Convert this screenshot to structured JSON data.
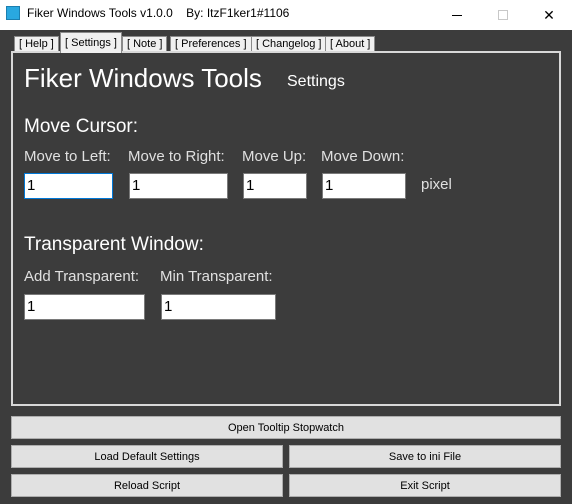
{
  "window": {
    "title": "Fiker Windows Tools v1.0.0    By: ItzF1ker1#1106"
  },
  "tabs": [
    {
      "label": "[ Help ]"
    },
    {
      "label": "[ Settings ]"
    },
    {
      "label": "[ Note ]"
    },
    {
      "label": "[ Preferences ]"
    },
    {
      "label": "[ Changelog ]"
    },
    {
      "label": "[ About ]"
    }
  ],
  "header": {
    "app_name": "Fiker Windows Tools",
    "page": "Settings"
  },
  "move_cursor": {
    "title": "Move Cursor:",
    "left_label": "Move to Left:",
    "right_label": "Move to Right:",
    "up_label": "Move Up:",
    "down_label": "Move Down:",
    "left_value": "1",
    "right_value": "1",
    "up_value": "1",
    "down_value": "1",
    "unit": "pixel"
  },
  "transparent": {
    "title": "Transparent Window:",
    "add_label": "Add Transparent:",
    "min_label": "Min Transparent:",
    "add_value": "1",
    "min_value": "1"
  },
  "buttons": {
    "stopwatch": "Open Tooltip Stopwatch",
    "load_default": "Load Default Settings",
    "save_ini": "Save to ini File",
    "reload": "Reload Script",
    "exit": "Exit Script"
  }
}
